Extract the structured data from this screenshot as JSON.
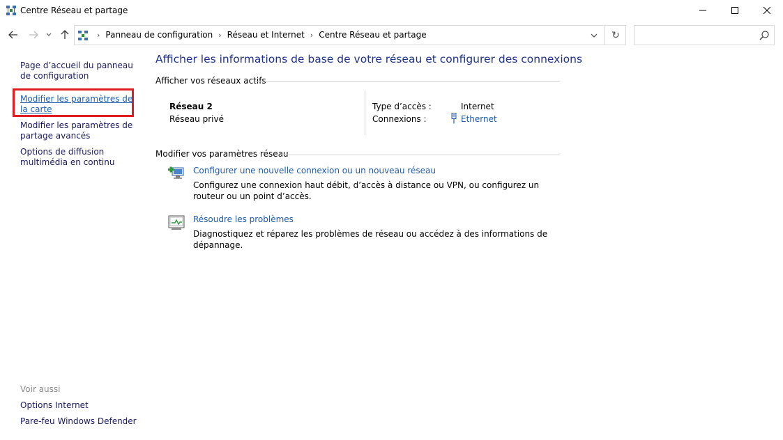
{
  "window": {
    "title": "Centre Réseau et partage",
    "icon": "network-center-icon"
  },
  "nav": {
    "breadcrumbs": [
      "Panneau de configuration",
      "Réseau et Internet",
      "Centre Réseau et partage"
    ],
    "search_placeholder": ""
  },
  "left_pane": {
    "home_link": "Page d’accueil du panneau de configuration",
    "adapter_link": "Modifier les paramètres de la carte",
    "sharing_link": "Modifier les paramètres de partage avancés",
    "streaming_link": "Options de diffusion multimédia en continu",
    "see_also": "Voir aussi",
    "internet_options": "Options Internet",
    "firewall": "Pare-feu Windows Defender"
  },
  "main": {
    "title": "Afficher les informations de base de votre réseau et configurer des connexions",
    "active_networks_heading": "Afficher vos réseaux actifs",
    "network": {
      "name": "Réseau 2",
      "type": "Réseau privé",
      "access_label": "Type d’accès :",
      "access_value": "Internet",
      "connections_label": "Connexions :",
      "connection_link": "Ethernet"
    },
    "modify_heading": "Modifier vos paramètres réseau",
    "tasks": [
      {
        "link": "Configurer une nouvelle connexion ou un nouveau réseau",
        "description": "Configurez une connexion haut débit, d’accès à distance ou VPN, ou configurez un routeur ou un point d’accès."
      },
      {
        "link": "Résoudre les problèmes",
        "description": "Diagnostiquez et réparez les problèmes de réseau ou accédez à des informations de dépannage."
      }
    ]
  },
  "colors": {
    "highlight": "#e11b22",
    "title_blue": "#1e3287",
    "link_blue": "#1e5aa8"
  }
}
